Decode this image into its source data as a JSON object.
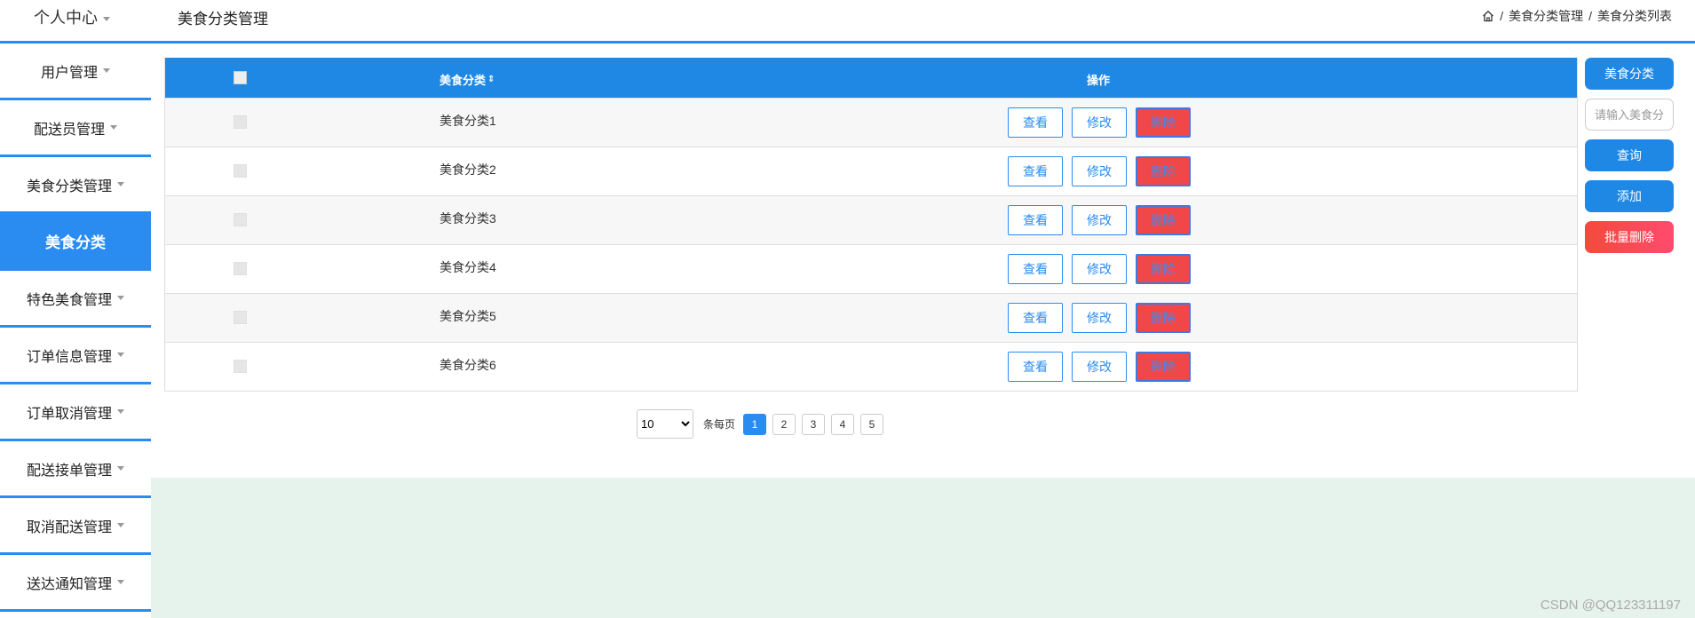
{
  "header": {
    "user_center": "个人中心",
    "page_title": "美食分类管理",
    "breadcrumb": [
      "美食分类管理",
      "美食分类列表"
    ],
    "separator": "/"
  },
  "sidebar": {
    "items": [
      {
        "label": "用户管理",
        "active": false
      },
      {
        "label": "配送员管理",
        "active": false
      },
      {
        "label": "美食分类管理",
        "active": false
      },
      {
        "label": "美食分类",
        "active": true
      },
      {
        "label": "特色美食管理",
        "active": false
      },
      {
        "label": "订单信息管理",
        "active": false
      },
      {
        "label": "订单取消管理",
        "active": false
      },
      {
        "label": "配送接单管理",
        "active": false
      },
      {
        "label": "取消配送管理",
        "active": false
      },
      {
        "label": "送达通知管理",
        "active": false
      }
    ]
  },
  "table": {
    "columns": {
      "name": "美食分类",
      "ops": "操作"
    },
    "rows": [
      {
        "name": "美食分类1"
      },
      {
        "name": "美食分类2"
      },
      {
        "name": "美食分类3"
      },
      {
        "name": "美食分类4"
      },
      {
        "name": "美食分类5"
      },
      {
        "name": "美食分类6"
      }
    ],
    "actions": {
      "view": "查看",
      "edit": "修改",
      "delete": "删除"
    }
  },
  "pagination": {
    "page_size": "10",
    "per_page_label": "条每页",
    "pages": [
      "1",
      "2",
      "3",
      "4",
      "5"
    ],
    "current": "1"
  },
  "right_panel": {
    "category_label": "美食分类",
    "search_placeholder": "请输入美食分类",
    "search_button": "查询",
    "add_button": "添加",
    "batch_delete_button": "批量删除"
  },
  "watermark": "CSDN @QQ123311197",
  "colors": {
    "accent": "#2a8cf0",
    "header_bg": "#1f88e5",
    "danger": "#f04848",
    "footer_bg": "#e6f3ec"
  }
}
